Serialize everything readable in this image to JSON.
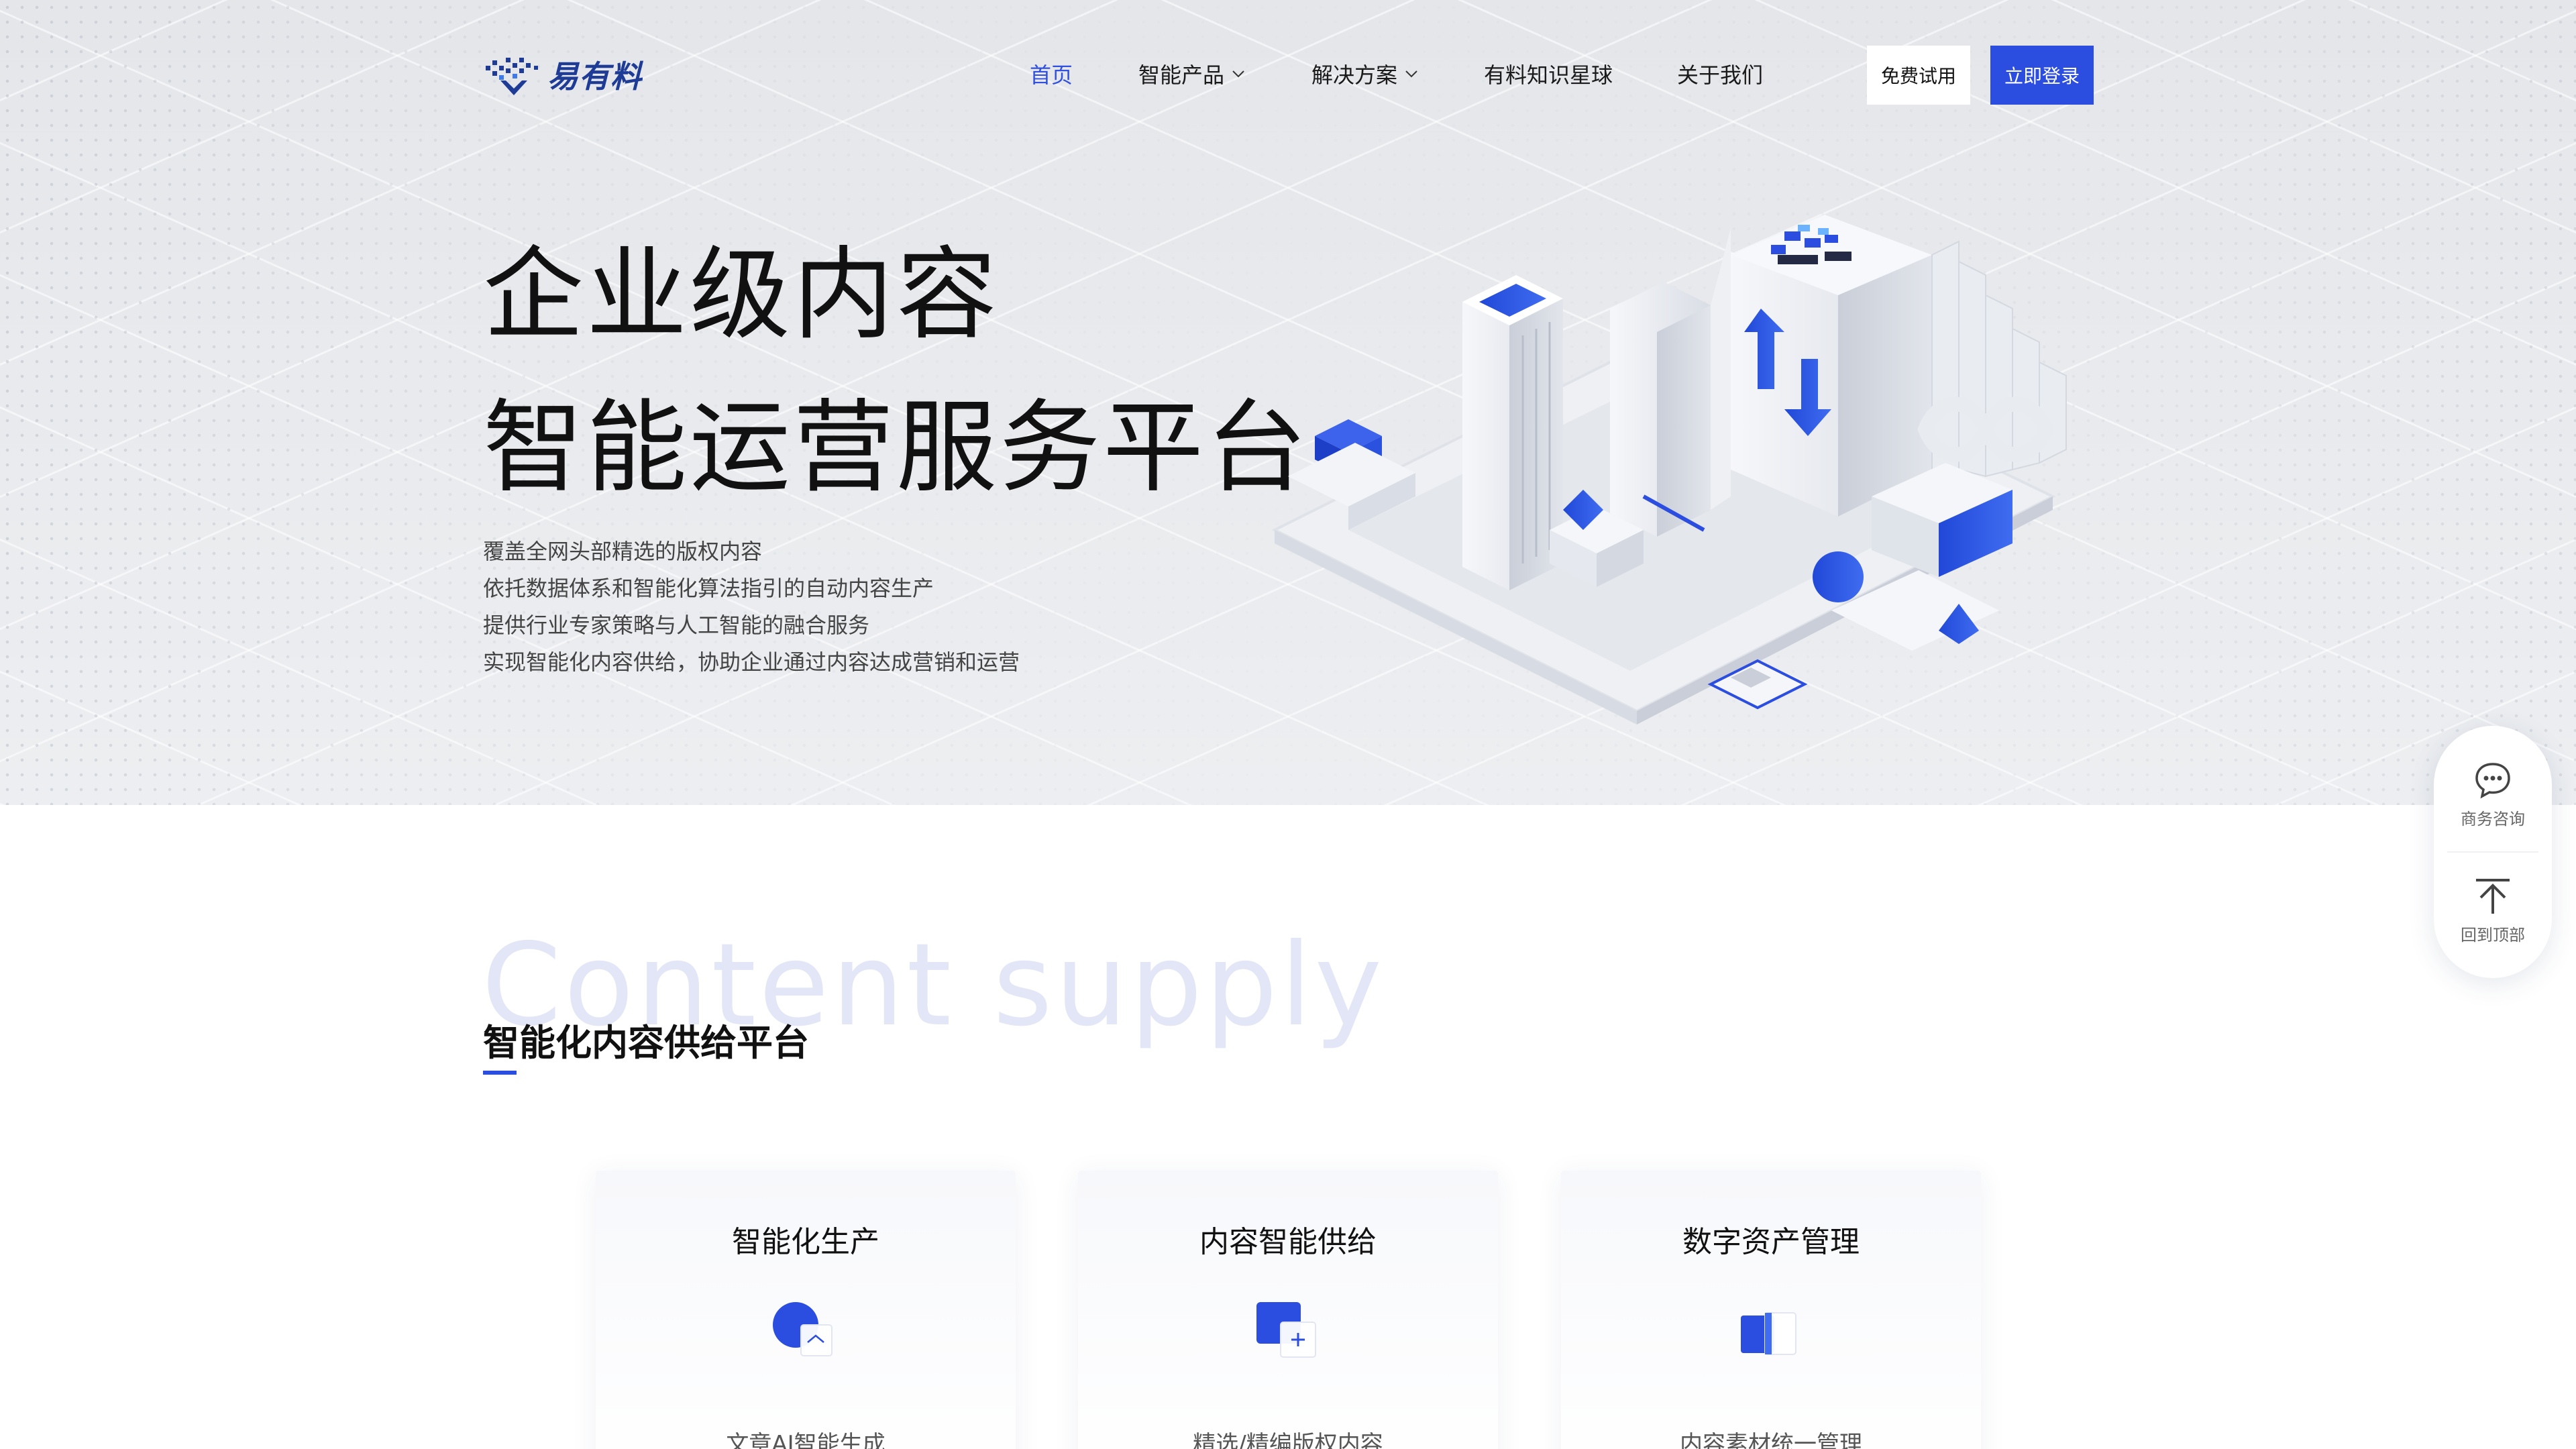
{
  "brand": {
    "name": "易有料"
  },
  "nav": {
    "items": [
      {
        "label": "首页",
        "active": true,
        "dropdown": false
      },
      {
        "label": "智能产品",
        "active": false,
        "dropdown": true
      },
      {
        "label": "解决方案",
        "active": false,
        "dropdown": true
      },
      {
        "label": "有料知识星球",
        "active": false,
        "dropdown": false
      },
      {
        "label": "关于我们",
        "active": false,
        "dropdown": false
      }
    ],
    "trial_label": "免费试用",
    "login_label": "立即登录"
  },
  "hero": {
    "title_line1": "企业级内容",
    "title_line2": "智能运营服务平台",
    "desc": [
      "覆盖全网头部精选的版权内容",
      "依托数据体系和智能化算法指引的自动内容生产",
      "提供行业专家策略与人工智能的融合服务",
      "实现智能化内容供给，协助企业通过内容达成营销和运营"
    ]
  },
  "float": {
    "consult_label": "商务咨询",
    "top_label": "回到顶部"
  },
  "section": {
    "watermark": "Content supply",
    "title": "智能化内容供给平台"
  },
  "cards": [
    {
      "title": "智能化生产",
      "icon": "ai-production-icon",
      "desc": "文章AI智能生成"
    },
    {
      "title": "内容智能供给",
      "icon": "content-supply-icon",
      "desc": "精选/精编版权内容"
    },
    {
      "title": "数字资产管理",
      "icon": "asset-management-icon",
      "desc": "内容素材统一管理"
    }
  ],
  "colors": {
    "accent": "#2b4de0",
    "brand": "#1e3b96",
    "hero_bg": "#e6e8ec",
    "watermark": "#e3e6f7"
  }
}
